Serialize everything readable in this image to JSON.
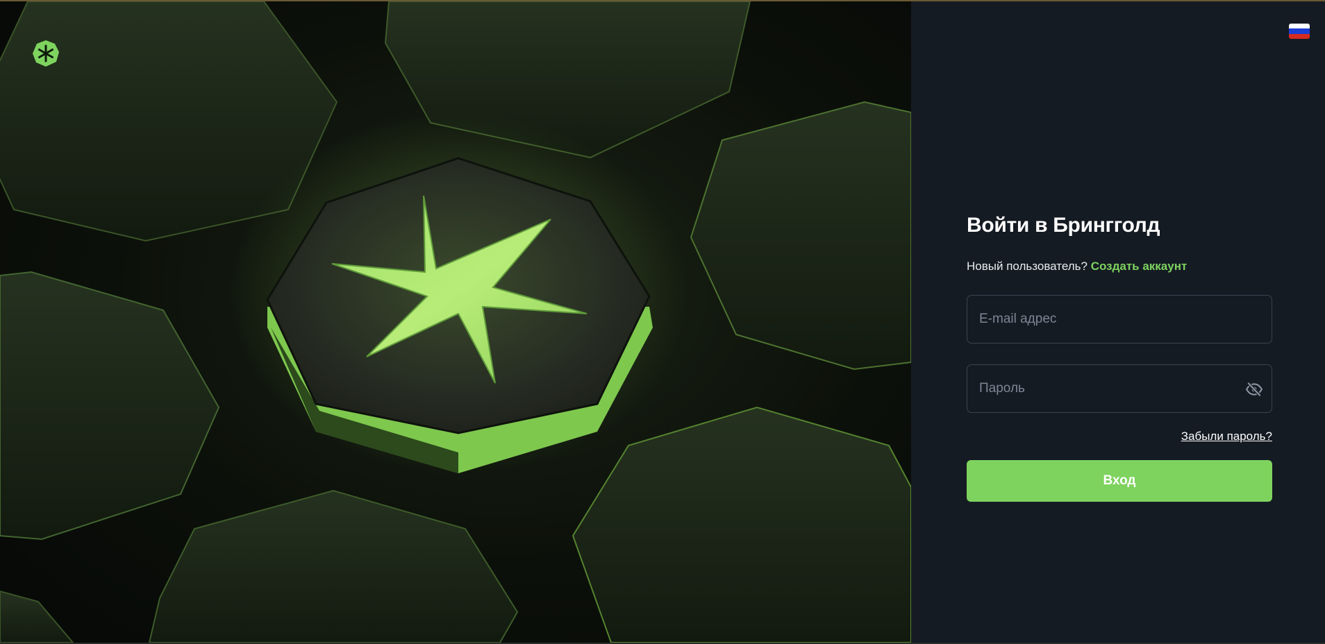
{
  "brand": {
    "logo_icon": "asterisk-octagon-logo-icon",
    "accent_color": "#7ed35f"
  },
  "hero": {
    "image": "green-asterisk-on-octagon-tiles",
    "icon": "asterisk-icon"
  },
  "language": {
    "flag_icon": "russia-flag-icon",
    "colors": [
      "#ffffff",
      "#1c3ed3",
      "#d52b1e"
    ]
  },
  "login": {
    "title": "Войти в Брингголд",
    "new_user_text": "Новый пользователь?",
    "create_account_link": "Создать аккаунт",
    "email_placeholder": "E-mail адрес",
    "email_value": "",
    "password_placeholder": "Пароль",
    "password_value": "",
    "toggle_visibility_icon": "eye-off-icon",
    "forgot_password_link": "Забыли пароль?",
    "submit_label": "Вход"
  }
}
